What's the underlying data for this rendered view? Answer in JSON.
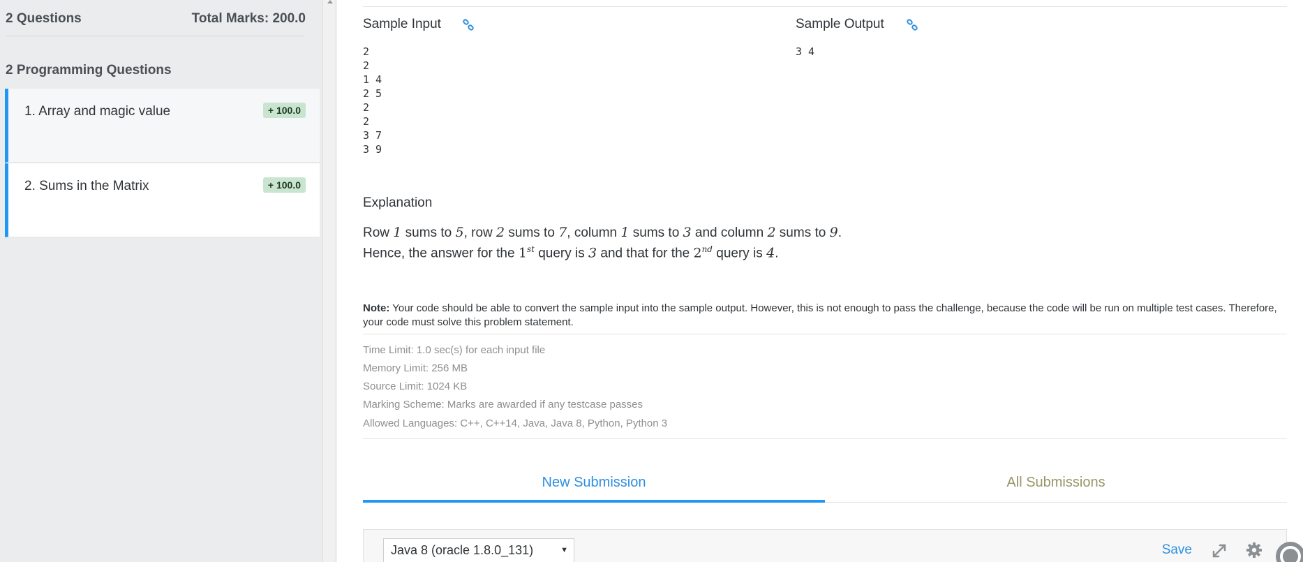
{
  "sidebar": {
    "question_count": "2 Questions",
    "total_marks": "Total Marks: 200.0",
    "section_title": "2 Programming Questions",
    "questions": [
      {
        "title": "1. Array and magic value",
        "marks": "+ 100.0"
      },
      {
        "title": "2. Sums in the Matrix",
        "marks": "+ 100.0"
      }
    ]
  },
  "problem": {
    "sample_input_label": "Sample Input",
    "sample_output_label": "Sample Output",
    "sample_input": "2\n2\n1 4\n2 5\n2\n2\n3 7\n3 9",
    "sample_output": "3 4",
    "explanation_title": "Explanation",
    "explanation": {
      "l1_a": "Row ",
      "l1_r1": "1",
      "l1_b": " sums to ",
      "l1_v1": "5",
      "l1_c": ", row ",
      "l1_r2": "2",
      "l1_d": " sums to ",
      "l1_v2": "7",
      "l1_e": ", column ",
      "l1_c1": "1",
      "l1_f": " sums to ",
      "l1_v3": "3",
      "l1_g": " and column ",
      "l1_c2": "2",
      "l1_h": " sums to ",
      "l1_v4": "9",
      "l1_end": ".",
      "l2_a": "Hence, the answer for the ",
      "l2_n1": "1",
      "l2_s1": "st",
      "l2_b": " query is ",
      "l2_v1": "3",
      "l2_c": " and that for the ",
      "l2_n2": "2",
      "l2_s2": "nd",
      "l2_d": " query is ",
      "l2_v2": "4",
      "l2_end": "."
    },
    "note_label": "Note:",
    "note_text": " Your code should be able to convert the sample input into the sample output. However, this is not enough to pass the challenge, because the code will be run on multiple test cases. Therefore, your code must solve this problem statement.",
    "limits": [
      "Time Limit: 1.0 sec(s) for each input file",
      "Memory Limit: 256 MB",
      "Source Limit: 1024 KB",
      "Marking Scheme: Marks are awarded if any testcase passes",
      "Allowed Languages: C++, C++14, Java, Java 8, Python, Python 3"
    ]
  },
  "tabs": {
    "new_submission": "New Submission",
    "all_submissions": "All Submissions"
  },
  "editor": {
    "language": "Java 8 (oracle 1.8.0_131)",
    "save_label": "Save"
  },
  "colors": {
    "accent": "#2196f3",
    "badge_bg": "#c9e4cf",
    "sidebar_bg": "#eaecee"
  }
}
